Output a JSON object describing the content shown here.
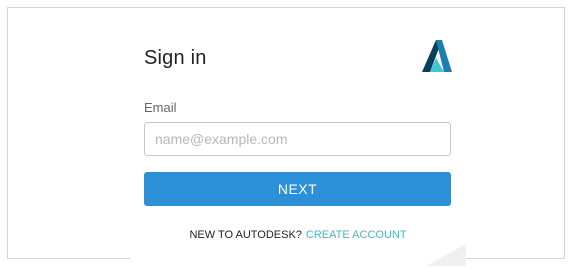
{
  "signin": {
    "title": "Sign in",
    "email_label": "Email",
    "email_placeholder": "name@example.com",
    "email_value": "",
    "next_label": "NEXT",
    "footer_prompt": "NEW TO AUTODESK?",
    "create_account_label": "CREATE ACCOUNT"
  },
  "logo": {
    "icon": "autodesk-logo-icon",
    "colors": {
      "dark": "#0b3d5c",
      "mid": "#1b7fb0",
      "light": "#3cc6d6"
    }
  },
  "colors": {
    "primary_button": "#2c90d8",
    "link": "#3fb7c6"
  }
}
